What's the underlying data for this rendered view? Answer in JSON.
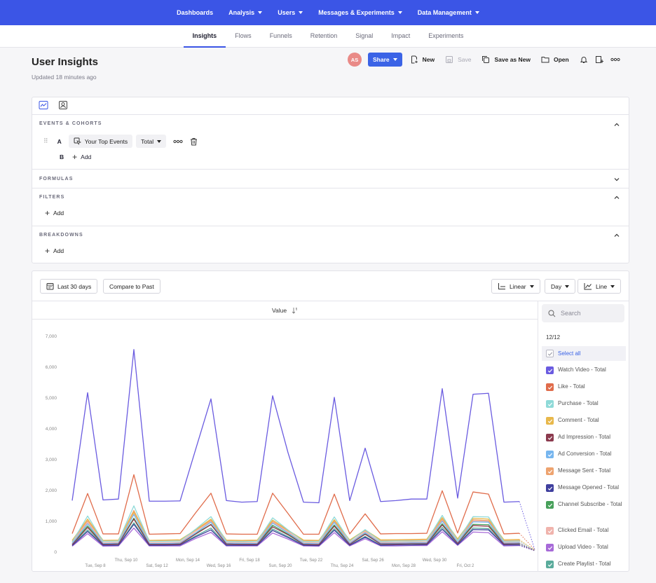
{
  "top_nav": [
    {
      "label": "Dashboards",
      "dropdown": false
    },
    {
      "label": "Analysis",
      "dropdown": true
    },
    {
      "label": "Users",
      "dropdown": true
    },
    {
      "label": "Messages & Experiments",
      "dropdown": true
    },
    {
      "label": "Data Management",
      "dropdown": true
    }
  ],
  "sub_nav": [
    "Insights",
    "Flows",
    "Funnels",
    "Retention",
    "Signal",
    "Impact",
    "Experiments"
  ],
  "sub_nav_active": "Insights",
  "page": {
    "title": "User Insights",
    "updated": "Updated 18 minutes ago"
  },
  "toolbar": {
    "avatar": "AS",
    "share": "Share",
    "new": "New",
    "save": "Save",
    "save_as_new": "Save as New",
    "open": "Open"
  },
  "query": {
    "events_title": "EVENTS & COHORTS",
    "row_a": {
      "letter": "A",
      "event": "Your Top Events",
      "measure": "Total"
    },
    "row_b": {
      "letter": "B",
      "add": "Add"
    },
    "formulas_title": "FORMULAS",
    "filters_title": "FILTERS",
    "filters_add": "Add",
    "breakdowns_title": "BREAKDOWNS",
    "breakdowns_add": "Add"
  },
  "controls": {
    "date_range": "Last 30 days",
    "compare": "Compare to Past",
    "scale": "Linear",
    "interval": "Day",
    "chart_type": "Line"
  },
  "value_header": "Value",
  "legend": {
    "search_placeholder": "Search",
    "count": "12/12",
    "select_all": "Select all",
    "items": [
      {
        "label": "Watch Video - Total",
        "color": "#6a5be0"
      },
      {
        "label": "Like - Total",
        "color": "#e06c4b"
      },
      {
        "label": "Purchase - Total",
        "color": "#8fdad8"
      },
      {
        "label": "Comment - Total",
        "color": "#e8b84b"
      },
      {
        "label": "Ad Impression - Total",
        "color": "#8b3a4e"
      },
      {
        "label": "Ad Conversion - Total",
        "color": "#77b6ef"
      },
      {
        "label": "Message Sent - Total",
        "color": "#eea36f"
      },
      {
        "label": "Message Opened - Total",
        "color": "#3f3f9e"
      },
      {
        "label": "Channel Subscribe - Total",
        "color": "#47a05a"
      },
      {
        "label": "Clicked Email - Total",
        "color": "#f0b3ac"
      },
      {
        "label": "Upload Video - Total",
        "color": "#a76ad8"
      },
      {
        "label": "Create Playlist - Total",
        "color": "#5aab9b"
      }
    ]
  },
  "chart_data": {
    "type": "line",
    "ylim": [
      0,
      7000
    ],
    "yticks": [
      "0",
      "1,000",
      "2,000",
      "3,000",
      "4,000",
      "5,000",
      "6,000",
      "7,000"
    ],
    "xtick_labels": [
      "Tue, Sep 8",
      "Thu, Sep 10",
      "Sat, Sep 12",
      "Mon, Sep 14",
      "Wed, Sep 16",
      "Fri, Sep 18",
      "Sun, Sep 20",
      "Tue, Sep 22",
      "Thu, Sep 24",
      "Sat, Sep 26",
      "Mon, Sep 28",
      "Wed, Sep 30",
      "Fri, Oct 2"
    ],
    "x": [
      "Sep 7",
      "Sep 8",
      "Sep 9",
      "Sep 10",
      "Sep 11",
      "Sep 12",
      "Sep 13",
      "Sep 14",
      "Sep 15",
      "Sep 16",
      "Sep 17",
      "Sep 18",
      "Sep 19",
      "Sep 20",
      "Sep 21",
      "Sep 22",
      "Sep 23",
      "Sep 24",
      "Sep 25",
      "Sep 26",
      "Sep 27",
      "Sep 28",
      "Sep 29",
      "Sep 30",
      "Oct 1",
      "Oct 2",
      "Oct 3",
      "Oct 4",
      "Oct 5",
      "Oct 6",
      "Oct 7"
    ],
    "series": [
      {
        "name": "Watch Video - Total",
        "color": "#6a5be0",
        "values": [
          1650,
          5150,
          1670,
          1700,
          6550,
          1630,
          1630,
          1640,
          3300,
          4950,
          1650,
          1600,
          1620,
          5050,
          3200,
          1600,
          1580,
          5000,
          1650,
          3350,
          1620,
          1650,
          1700,
          1700,
          5280,
          1730,
          5100,
          5130,
          1600,
          1620,
          60
        ]
      },
      {
        "name": "Like - Total",
        "color": "#e06c4b",
        "values": [
          580,
          1880,
          570,
          570,
          2490,
          560,
          570,
          580,
          1250,
          1890,
          570,
          560,
          560,
          1890,
          1230,
          560,
          560,
          1860,
          570,
          1220,
          570,
          580,
          580,
          590,
          1970,
          600,
          1930,
          1860,
          570,
          590,
          60
        ]
      },
      {
        "name": "Purchase - Total",
        "color": "#8fdad8",
        "values": [
          300,
          1150,
          330,
          340,
          1480,
          330,
          330,
          340,
          720,
          1130,
          330,
          320,
          330,
          1090,
          700,
          320,
          320,
          1120,
          330,
          710,
          330,
          340,
          340,
          350,
          1170,
          350,
          1130,
          1120,
          330,
          340,
          40
        ]
      },
      {
        "name": "Comment - Total",
        "color": "#e8b84b",
        "values": [
          360,
          1050,
          360,
          370,
          1280,
          360,
          370,
          380,
          700,
          1050,
          370,
          360,
          370,
          1020,
          690,
          370,
          360,
          1030,
          370,
          700,
          380,
          380,
          390,
          400,
          1100,
          410,
          1080,
          1050,
          380,
          390,
          40
        ]
      },
      {
        "name": "Ad Impression - Total",
        "color": "#8b3a4e",
        "values": [
          220,
          780,
          230,
          240,
          1050,
          230,
          230,
          240,
          560,
          870,
          240,
          230,
          230,
          800,
          540,
          230,
          220,
          820,
          230,
          560,
          240,
          240,
          250,
          250,
          860,
          260,
          840,
          820,
          240,
          250,
          30
        ]
      },
      {
        "name": "Ad Conversion - Total",
        "color": "#77b6ef",
        "values": [
          250,
          900,
          260,
          270,
          1200,
          260,
          260,
          270,
          600,
          950,
          270,
          260,
          260,
          920,
          600,
          260,
          250,
          940,
          260,
          610,
          270,
          270,
          280,
          280,
          980,
          290,
          960,
          950,
          270,
          280,
          30
        ]
      },
      {
        "name": "Message Sent - Total",
        "color": "#eea36f",
        "values": [
          330,
          1000,
          340,
          350,
          1330,
          340,
          340,
          350,
          690,
          1010,
          350,
          340,
          340,
          980,
          670,
          340,
          340,
          990,
          350,
          680,
          350,
          360,
          360,
          370,
          1050,
          380,
          1030,
          1000,
          350,
          360,
          40
        ]
      },
      {
        "name": "Message Opened - Total",
        "color": "#3f3f9e",
        "values": [
          190,
          650,
          200,
          200,
          880,
          200,
          200,
          210,
          470,
          700,
          200,
          200,
          200,
          680,
          450,
          200,
          190,
          690,
          200,
          460,
          200,
          210,
          210,
          220,
          720,
          220,
          710,
          700,
          210,
          210,
          30
        ]
      },
      {
        "name": "Channel Subscribe - Total",
        "color": "#47a05a",
        "values": [
          240,
          830,
          250,
          260,
          1080,
          250,
          250,
          260,
          580,
          880,
          260,
          250,
          250,
          850,
          560,
          250,
          240,
          860,
          250,
          570,
          260,
          260,
          270,
          270,
          900,
          280,
          880,
          870,
          260,
          270,
          30
        ]
      },
      {
        "name": "Clicked Email - Total",
        "color": "#f0b3ac",
        "values": [
          280,
          950,
          290,
          300,
          1230,
          290,
          290,
          300,
          650,
          980,
          300,
          290,
          290,
          950,
          630,
          290,
          280,
          970,
          290,
          640,
          300,
          300,
          310,
          310,
          1020,
          320,
          990,
          980,
          300,
          310,
          40
        ]
      },
      {
        "name": "Upload Video - Total",
        "color": "#a76ad8",
        "values": [
          170,
          580,
          170,
          180,
          760,
          180,
          180,
          180,
          420,
          620,
          180,
          180,
          180,
          600,
          400,
          180,
          170,
          610,
          180,
          410,
          180,
          180,
          190,
          190,
          640,
          200,
          630,
          610,
          180,
          190,
          20
        ]
      },
      {
        "name": "Create Playlist - Total",
        "color": "#5aab9b",
        "values": [
          200,
          700,
          210,
          210,
          930,
          210,
          210,
          220,
          500,
          760,
          210,
          210,
          210,
          730,
          480,
          210,
          200,
          740,
          210,
          490,
          210,
          220,
          220,
          230,
          780,
          230,
          760,
          740,
          220,
          220,
          30
        ]
      }
    ]
  }
}
